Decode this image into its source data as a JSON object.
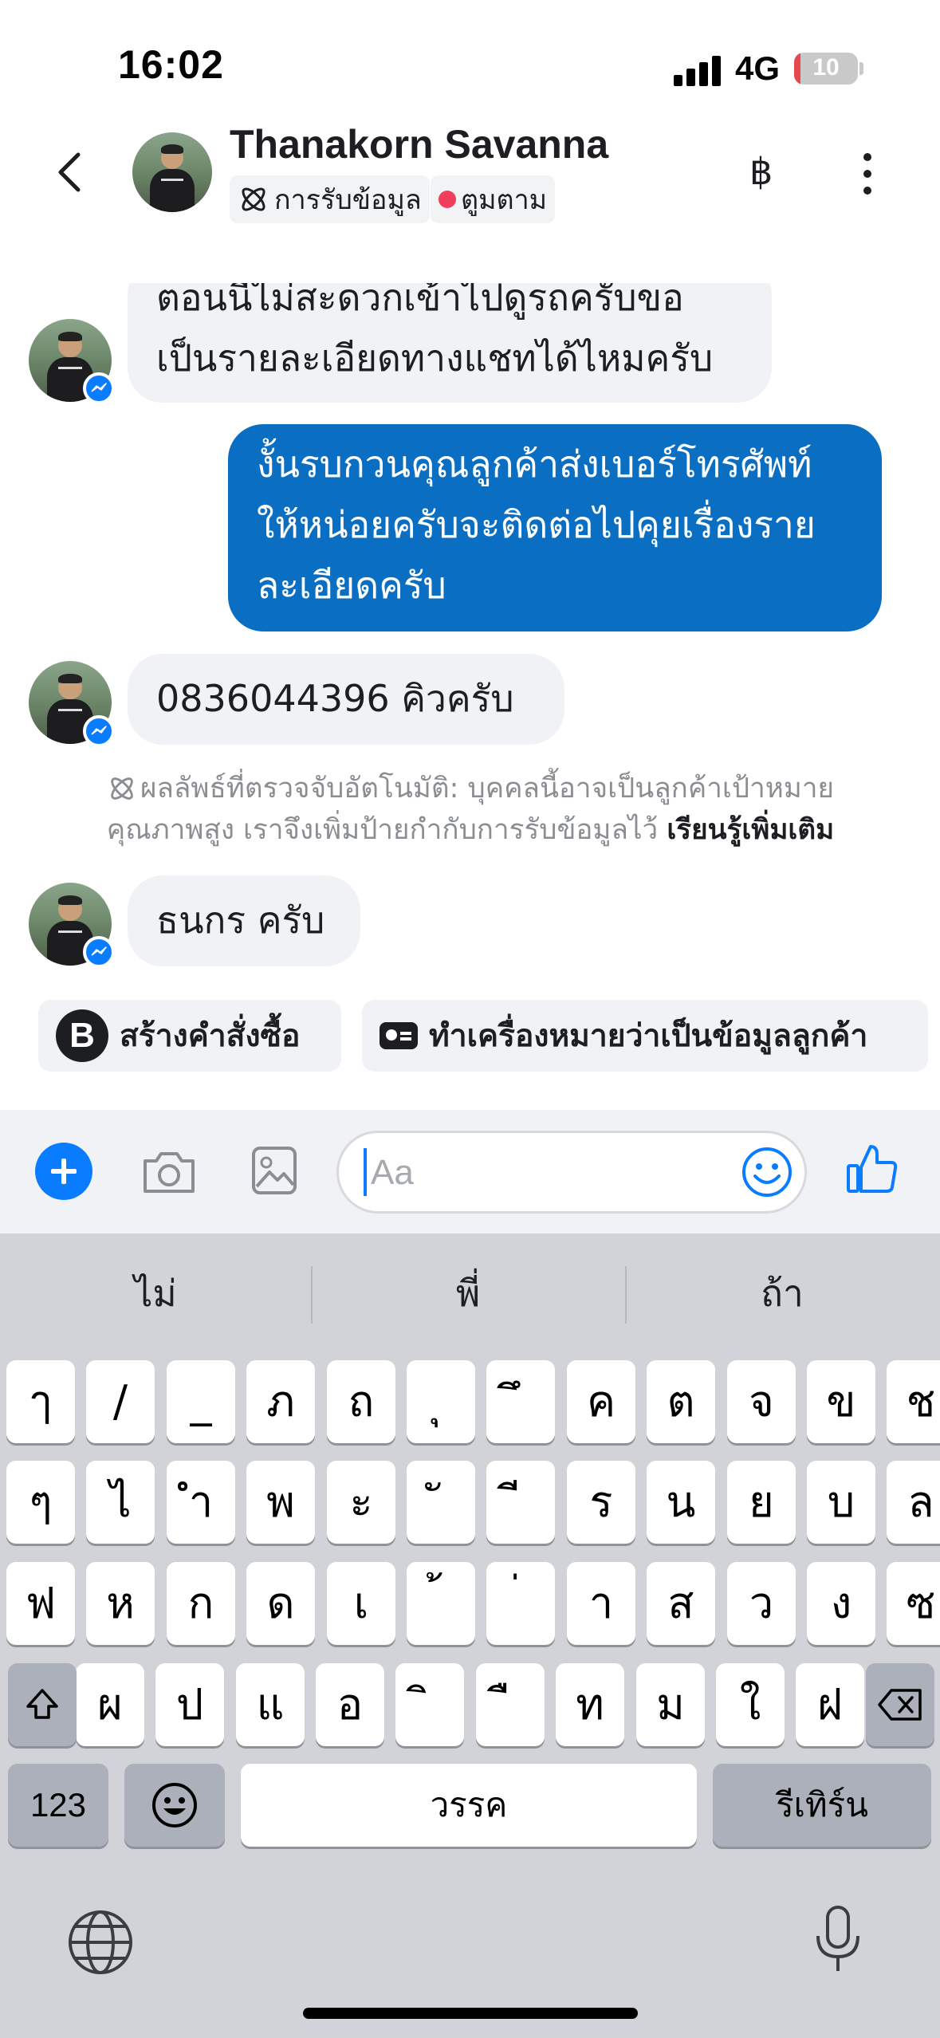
{
  "status_bar": {
    "time": "16:02",
    "network": "4G",
    "battery": "10",
    "battery_level": 0.1
  },
  "header": {
    "name": "Thanakorn Savanna",
    "tags": [
      "การรับข้อมูล",
      "ตูมตาม"
    ],
    "currency_icon": "฿"
  },
  "messages": [
    {
      "direction": "in",
      "lines": [
        "ตอนนี้ไม่สะดวกเข้าไปดูรถครับขอ",
        "เป็นรายละเอียดทางแชทได้ไหมครับ"
      ]
    },
    {
      "direction": "out",
      "lines": [
        "งั้นรบกวนคุณลูกค้าส่งเบอร์โทรศัพท์",
        "ให้หน่อยครับจะติดต่อไปคุยเรื่องราย",
        "ละเอียดครับ"
      ]
    },
    {
      "direction": "in",
      "lines": [
        "0836044396 คิวครับ"
      ]
    },
    {
      "direction": "in",
      "lines": [
        "ธนกร ครับ"
      ]
    }
  ],
  "system_note": {
    "line1": "ผลลัพธ์ที่ตรวจจับอัตโนมัติ: บุคคลนี้อาจเป็นลูกค้าเป้าหมาย",
    "line2": "คุณภาพสูง เราจึงเพิ่มป้ายกำกับการรับข้อมูลไว้",
    "link": "เรียนรู้เพิ่มเติม"
  },
  "quick_actions": [
    {
      "label": "สร้างคำสั่งซื้อ",
      "icon": "B"
    },
    {
      "label": "ทำเครื่องหมายว่าเป็นข้อมูลลูกค้า",
      "icon": "id-card-icon"
    }
  ],
  "composer": {
    "placeholder": "Aa"
  },
  "keyboard": {
    "suggestions": [
      "ไม่",
      "พี่",
      "ถ้า"
    ],
    "rows": [
      [
        "ๅ",
        "/",
        "_",
        "ภ",
        "ถ",
        "ุ",
        "ึ",
        "ค",
        "ต",
        "จ",
        "ข",
        "ช"
      ],
      [
        "ๆ",
        "ไ",
        "ำ",
        "พ",
        "ะ",
        "ั",
        "ี",
        "ร",
        "น",
        "ย",
        "บ",
        "ล"
      ],
      [
        "ฟ",
        "ห",
        "ก",
        "ด",
        "เ",
        "้",
        "่",
        "า",
        "ส",
        "ว",
        "ง",
        "ซ"
      ],
      [
        "ผ",
        "ป",
        "แ",
        "อ",
        "ิ",
        "ื",
        "ท",
        "ม",
        "ใ",
        "ฝ"
      ]
    ],
    "numbers_key": "123",
    "space_key": "วรรค",
    "return_key": "รีเทิร์น"
  }
}
